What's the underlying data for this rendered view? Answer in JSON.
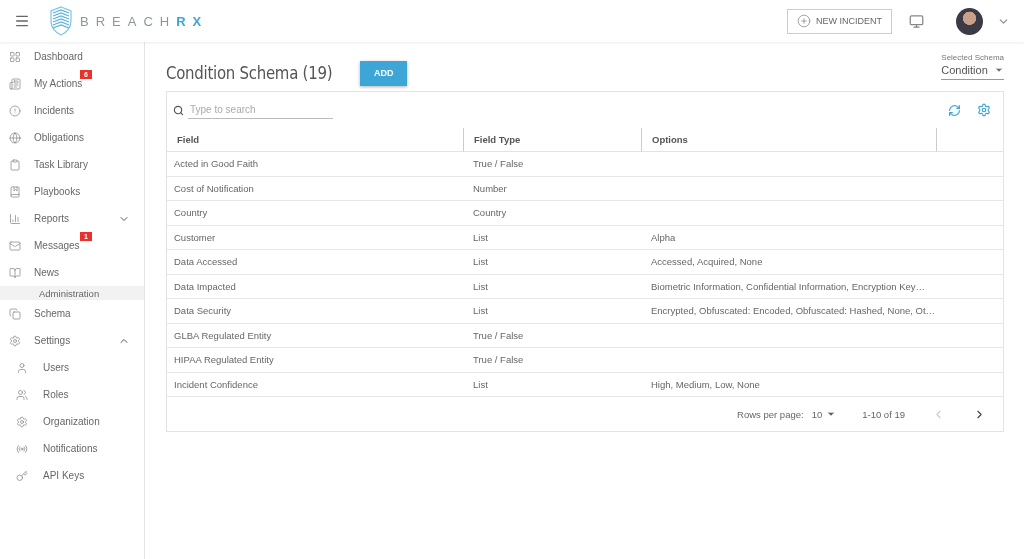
{
  "logo": {
    "text": "BREACH",
    "accent": "RX"
  },
  "header": {
    "new_incident": "NEW INCIDENT"
  },
  "sidebar": {
    "items": [
      {
        "kind": "item",
        "label": "Dashboard"
      },
      {
        "kind": "item",
        "label": "My Actions",
        "badge": "6"
      },
      {
        "kind": "item",
        "label": "Incidents"
      },
      {
        "kind": "item",
        "label": "Obligations"
      },
      {
        "kind": "item",
        "label": "Task Library"
      },
      {
        "kind": "item",
        "label": "Playbooks"
      },
      {
        "kind": "item",
        "label": "Reports",
        "expanded": false
      },
      {
        "kind": "item",
        "label": "Messages",
        "badge": "1"
      },
      {
        "kind": "item",
        "label": "News"
      },
      {
        "kind": "section",
        "label": "Administration"
      },
      {
        "kind": "item",
        "label": "Schema"
      },
      {
        "kind": "item",
        "label": "Settings",
        "expanded": true,
        "children": [
          {
            "kind": "subitem",
            "label": "Users"
          },
          {
            "kind": "subitem",
            "label": "Roles"
          },
          {
            "kind": "subitem",
            "label": "Organization"
          },
          {
            "kind": "subitem",
            "label": "Notifications"
          },
          {
            "kind": "subitem",
            "label": "API Keys"
          }
        ]
      }
    ]
  },
  "page": {
    "title": "Condition Schema (19)",
    "add_button": "ADD",
    "schema_select": {
      "label": "Selected Schema",
      "value": "Condition"
    }
  },
  "table": {
    "search": {
      "placeholder": "Type to search"
    },
    "columns": [
      "Field",
      "Field Type",
      "Options"
    ],
    "rows": [
      [
        "Acted in Good Faith",
        "True / False",
        ""
      ],
      [
        "Cost of Notification",
        "Number",
        ""
      ],
      [
        "Country",
        "Country",
        ""
      ],
      [
        "Customer",
        "List",
        "Alpha"
      ],
      [
        "Data Accessed",
        "List",
        "Accessed, Acquired, None"
      ],
      [
        "Data Impacted",
        "List",
        "Biometric Information, Confidential Information, Encryption Key…"
      ],
      [
        "Data Security",
        "List",
        "Encrypted, Obfuscated: Encoded, Obfuscated: Hashed, None, Ot…"
      ],
      [
        "GLBA Regulated Entity",
        "True / False",
        ""
      ],
      [
        "HIPAA Regulated Entity",
        "True / False",
        ""
      ],
      [
        "Incident Confidence",
        "List",
        "High, Medium, Low, None"
      ]
    ],
    "pagination": {
      "rows_label": "Rows per page:",
      "rows_value": "10",
      "range": "1-10 of 19",
      "prev_disabled": true,
      "next_disabled": false
    }
  }
}
